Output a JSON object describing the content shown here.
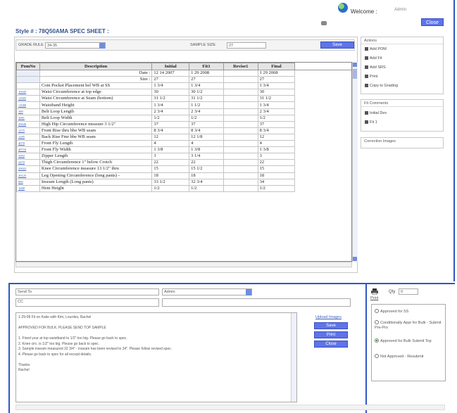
{
  "header": {
    "welcome_label": "Welcome :",
    "user_name": "Admin",
    "close_label": "Close",
    "style_title": "Style # : 78Q50AMA SPEC SHEET :"
  },
  "grade_bar": {
    "grade_rule_label": "GRADE RULE",
    "grade_rule_value": "34-35",
    "sample_size_label": "SAMPLE SIZE",
    "sample_size_value": "27",
    "save_label": "Save"
  },
  "table": {
    "columns": [
      "PomNo",
      "Description",
      "Initial",
      "Fit1",
      "Revise1",
      "Final"
    ],
    "date_row": {
      "label": "Date :",
      "initial": "12 14 2007",
      "fit1": "1 29 2008",
      "final": "1 29 2008"
    },
    "size_row": {
      "label": "Size :",
      "initial": "27",
      "fit1": "27",
      "final": "27"
    },
    "rows": [
      {
        "pom": "",
        "desc": "Coin Pocket Placement bel WB at SS",
        "initial": "1 3/4",
        "fit1": "1 3/4",
        "revise1": "",
        "final": "1 3/4"
      },
      {
        "pom": "10045",
        "desc": "Waist Circumference at top edge",
        "initial": "30",
        "fit1": "30 1/2",
        "revise1": "",
        "final": "30"
      },
      {
        "pom": "11005",
        "desc": "Waist Circumference at Seam (bottom)",
        "initial": "31 1/2",
        "fit1": "31 1/2",
        "revise1": "",
        "final": "31 1/2"
      },
      {
        "pom": "11080",
        "desc": "Waistband Height",
        "initial": "1 3/4",
        "fit1": "1 1/2",
        "revise1": "",
        "final": "1 3/4"
      },
      {
        "pom": "380",
        "desc": "Belt Loop Length",
        "initial": "2 3/4",
        "fit1": "2 3/4",
        "revise1": "",
        "final": "2 3/4"
      },
      {
        "pom": "3081",
        "desc": "Belt Loop Width",
        "initial": "1/2",
        "fit1": "1/2",
        "revise1": "",
        "final": "1/2"
      },
      {
        "pom": "20040",
        "desc": "High Hip Circumference measure 3 1/2\"",
        "initial": "37",
        "fit1": "37",
        "revise1": "",
        "final": "37"
      },
      {
        "pom": "1275",
        "desc": "Front Rise thru bbe WB seam",
        "initial": "8 3/4",
        "fit1": "8 3/4",
        "revise1": "",
        "final": "8 3/4"
      },
      {
        "pom": "1285",
        "desc": "Back Rise Fmr bbe WB seam",
        "initial": "12",
        "fit1": "12 1/8",
        "revise1": "",
        "final": "12"
      },
      {
        "pom": "4070",
        "desc": "Front Fly Length",
        "initial": "4",
        "fit1": "4",
        "revise1": "",
        "final": "4"
      },
      {
        "pom": "40710",
        "desc": "Front Fly Width",
        "initial": "1 3/8",
        "fit1": "1 3/8",
        "revise1": "",
        "final": "1 3/8"
      },
      {
        "pom": "3082",
        "desc": "Zipper Length",
        "initial": "3",
        "fit1": "3 1/4",
        "revise1": "",
        "final": "3"
      },
      {
        "pom": "2470",
        "desc": "Thigh Circumference 1\" below Crotch",
        "initial": "22",
        "fit1": "22",
        "revise1": "",
        "final": "22"
      },
      {
        "pom": "20022",
        "desc": "Knee Circumference measure 13 1/2\" thru",
        "initial": "15",
        "fit1": "15 1/2",
        "revise1": "",
        "final": "15"
      },
      {
        "pom": "26125",
        "desc": "Leg Opening Circumference (long pants) -",
        "initial": "18",
        "fit1": "18",
        "revise1": "",
        "final": "18"
      },
      {
        "pom": "880",
        "desc": "Inseam Length (Long pants)",
        "initial": "33 1/2",
        "fit1": "32 3/4",
        "revise1": "",
        "final": "34"
      },
      {
        "pom": "1680",
        "desc": "Hem Height",
        "initial": "1/2",
        "fit1": "1/2",
        "revise1": "",
        "final": "1/2"
      }
    ]
  },
  "actions": {
    "title": "Actions",
    "items": [
      "Add POM",
      "Add Fit",
      "Add SRS",
      "Print",
      "Copy to Grading"
    ]
  },
  "fit_comments": {
    "title": "Fit Comments",
    "items": [
      "Initial Dev",
      "Fit 1"
    ]
  },
  "correction_images": {
    "title": "Correction Images"
  },
  "mail": {
    "send_to_label": "Send To",
    "send_to_value": "Admin",
    "cc_label": "CC",
    "message_lines": [
      "1-29-08 Fit on Katie with Kim, Lourdes, Rachel",
      "",
      "APPROVED FOR BULK. PLEASE SEND TOP SAMPLE",
      "",
      "1. Fixed your  at top waistband to 1/2\" too big.  Please go back to spec.",
      "2. Knee circ. is 1/2\" too big.  Please go back to spec.",
      "3. Sample inseam measured 32 3/4\" - inseam has been revised to 34\".  Please follow revised spec.",
      "4. Please go back to spec for all except details.",
      "",
      "Thanks",
      "Rachel"
    ],
    "upload_label": "Upload Images",
    "save_label": "Save",
    "print_label": "Print",
    "close_label": "Close"
  },
  "approval": {
    "qty_label": "Qty",
    "qty_value": "0",
    "print_label": "Print",
    "options": [
      {
        "label": "Approved for SS",
        "selected": false
      },
      {
        "label": "Conditionally Appr for Bulk - Submit Pre-Pro",
        "selected": false
      },
      {
        "label": "Approved for Bulk Submit Top",
        "selected": true
      },
      {
        "label": "Not Approved - Resubmit",
        "selected": false
      }
    ]
  },
  "colors": {
    "accent": "#5e74e8",
    "frame": "#2f55c8",
    "title": "#33508c"
  }
}
